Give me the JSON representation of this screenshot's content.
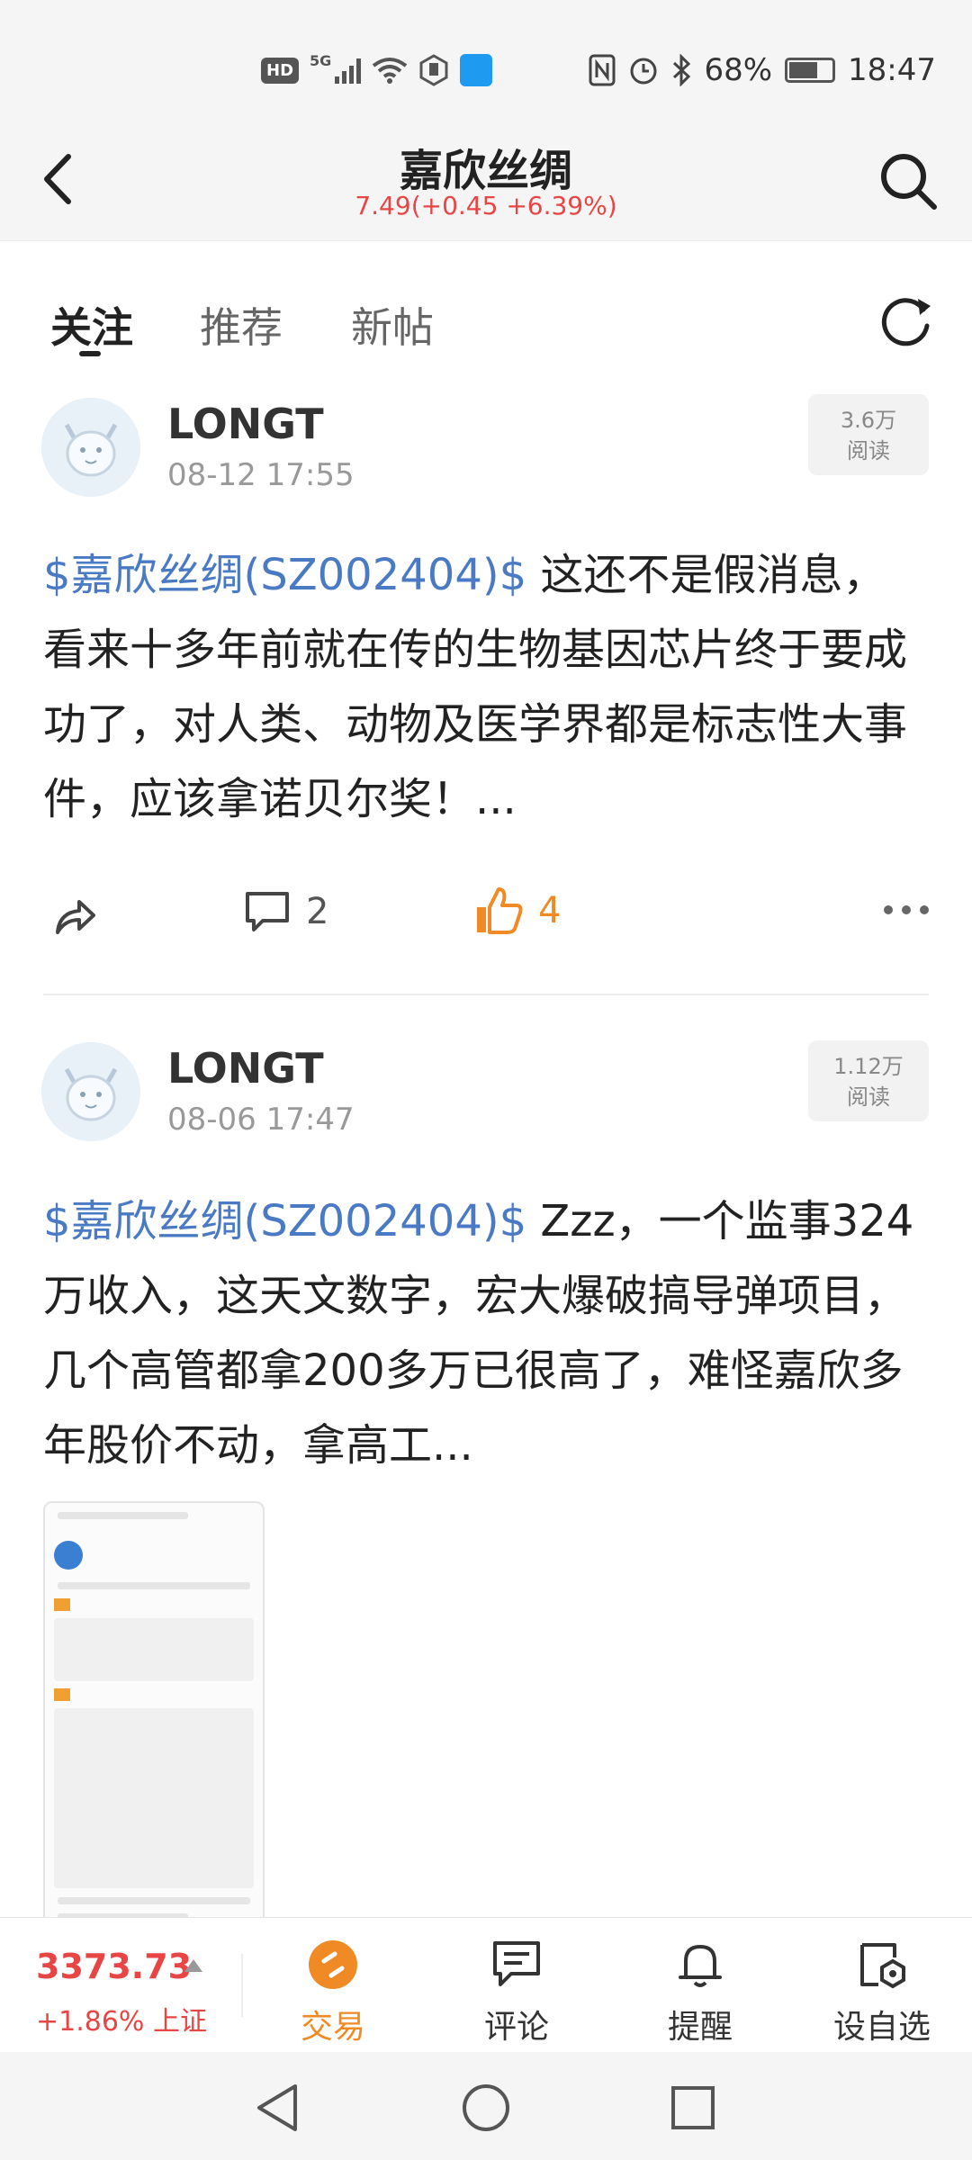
{
  "status_bar": {
    "hd": "HD",
    "signal": "5G",
    "battery": "68%",
    "time": "18:47"
  },
  "header": {
    "title": "嘉欣丝绸",
    "quote": "7.49(+0.45 +6.39%)"
  },
  "tabs": [
    {
      "label": "关注",
      "active": true
    },
    {
      "label": "推荐",
      "active": false
    },
    {
      "label": "新帖",
      "active": false
    }
  ],
  "posts": [
    {
      "username": "LONGT",
      "time": "08-12 17:55",
      "reads_count": "3.6万",
      "reads_label": "阅读",
      "stock_tag": "$嘉欣丝绸(SZ002404)$",
      "text": " 这还不是假消息，看来十多年前就在传的生物基因芯片终于要成功了，对人类、动物及医学界都是标志性大事件，应该拿诺贝尔奖！...",
      "comments": "2",
      "likes": "4"
    },
    {
      "username": "LONGT",
      "time": "08-06 17:47",
      "reads_count": "1.12万",
      "reads_label": "阅读",
      "stock_tag": "$嘉欣丝绸(SZ002404)$",
      "text": " Zzz，一个监事324万收入，这天文数字，宏大爆破搞导弹项目，几个高管都拿200多万已很高了，难怪嘉欣多年股价不动，拿高工...",
      "has_image": true
    }
  ],
  "bottom_bar": {
    "index_value": "3373.73",
    "index_change": "+1.86% 上证",
    "tabs": [
      {
        "label": "交易",
        "icon": "trade-icon"
      },
      {
        "label": "评论",
        "icon": "comment-icon"
      },
      {
        "label": "提醒",
        "icon": "bell-icon"
      },
      {
        "label": "设自选",
        "icon": "add-watchlist-icon"
      }
    ]
  },
  "colors": {
    "accent_orange": "#f08a24",
    "price_red": "#e84545",
    "stock_link_blue": "#4a7ac4"
  }
}
